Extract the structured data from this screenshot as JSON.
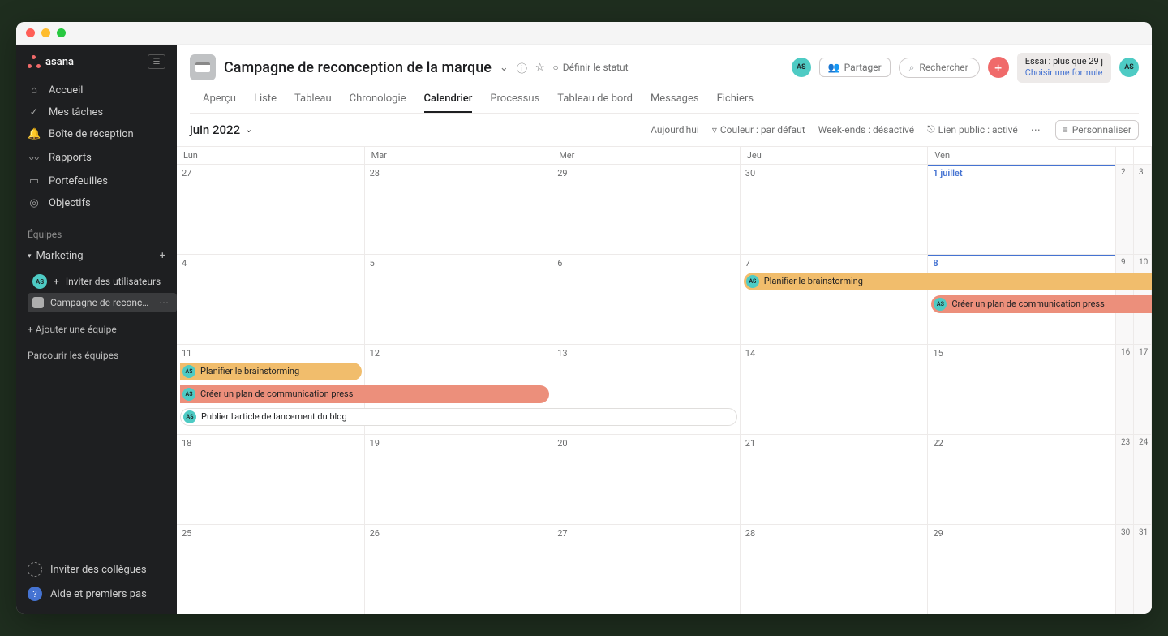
{
  "brand": "asana",
  "sidebar": {
    "nav": [
      {
        "icon": "⌂",
        "label": "Accueil"
      },
      {
        "icon": "✓",
        "label": "Mes tâches"
      },
      {
        "icon": "🔔",
        "label": "Boîte de réception"
      },
      {
        "icon": "〰",
        "label": "Rapports"
      },
      {
        "icon": "▭",
        "label": "Portefeuilles"
      },
      {
        "icon": "◎",
        "label": "Objectifs"
      }
    ],
    "teams_label": "Équipes",
    "team": "Marketing",
    "invite": "Inviter des utilisateurs",
    "project": "Campagne de reconc…",
    "add_team": "+ Ajouter une équipe",
    "browse": "Parcourir les équipes",
    "invite_colleagues": "Inviter des collègues",
    "help": "Aide et premiers pas"
  },
  "header": {
    "title": "Campagne de reconception de la marque",
    "set_status": "Définir le statut",
    "share": "Partager",
    "search_placeholder": "Rechercher",
    "trial_days": "Essai : plus que 29 j",
    "trial_link": "Choisir une formule",
    "avatar": "AS"
  },
  "tabs": [
    "Aperçu",
    "Liste",
    "Tableau",
    "Chronologie",
    "Calendrier",
    "Processus",
    "Tableau de bord",
    "Messages",
    "Fichiers"
  ],
  "active_tab": 4,
  "toolbar": {
    "month": "juin 2022",
    "today": "Aujourd'hui",
    "color": "Couleur : par défaut",
    "weekends": "Week-ends : désactivé",
    "public": "Lien public : activé",
    "customize": "Personnaliser"
  },
  "day_headers": [
    "Lun",
    "Mar",
    "Mer",
    "Jeu",
    "Ven"
  ],
  "weeks": [
    {
      "cells": [
        "27",
        "28",
        "29",
        "30",
        "1 juillet",
        "2",
        "3"
      ],
      "today_idx": 4
    },
    {
      "cells": [
        "4",
        "5",
        "6",
        "7",
        "8",
        "9",
        "10"
      ],
      "today_idx": 4
    },
    {
      "cells": [
        "11",
        "12",
        "13",
        "14",
        "15",
        "16",
        "17"
      ]
    },
    {
      "cells": [
        "18",
        "19",
        "20",
        "21",
        "22",
        "23",
        "24"
      ]
    },
    {
      "cells": [
        "25",
        "26",
        "27",
        "28",
        "29",
        "30",
        "31"
      ]
    }
  ],
  "tasks": {
    "brainstorm": "Planifier le brainstorming",
    "press": "Créer un plan de communication press",
    "blog": "Publier l'article de lancement du blog"
  }
}
